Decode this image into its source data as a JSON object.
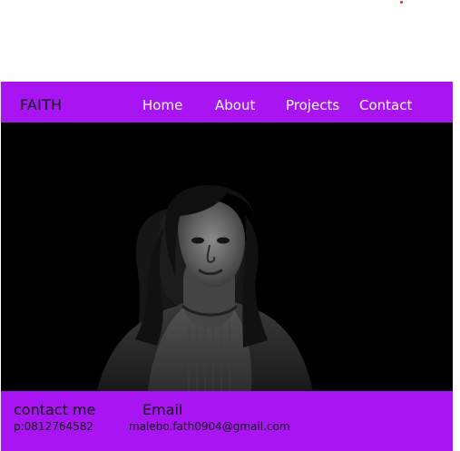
{
  "header": {
    "brand": "FAITH",
    "nav": [
      {
        "label": "Home"
      },
      {
        "label": "About"
      },
      {
        "label": "Projects"
      },
      {
        "label": "Contact"
      }
    ]
  },
  "hero": {
    "image": "portrait-photo-grayscale"
  },
  "footer": {
    "contact_heading": "contact me",
    "email_heading": "Email",
    "phone": "p:0812764582",
    "email": "malebo.fath0904@gmail.com"
  },
  "colors": {
    "accent": "#a914f2",
    "hero_background": "#000000",
    "text_dark": "#111111",
    "nav_text": "#ffffff",
    "marker": "#c0392b"
  }
}
